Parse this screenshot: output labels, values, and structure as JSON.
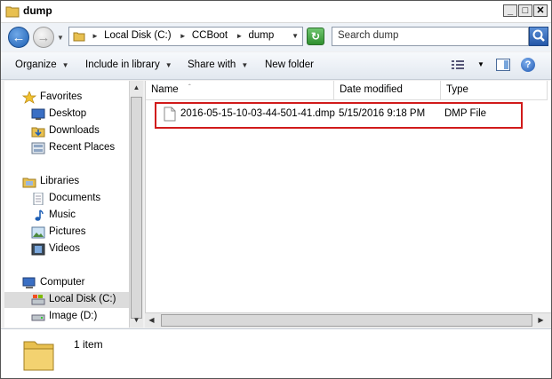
{
  "window": {
    "title": "dump",
    "minimize": "_",
    "maximize": "□",
    "close": "✕"
  },
  "address": {
    "crumbs": [
      "Local Disk (C:)",
      "CCBoot",
      "dump"
    ],
    "search_placeholder": "Search dump"
  },
  "toolbar": {
    "organize": "Organize",
    "include_in_library": "Include in library",
    "share_with": "Share with",
    "new_folder": "New folder"
  },
  "nav": {
    "favorites": "Favorites",
    "desktop": "Desktop",
    "downloads": "Downloads",
    "recent_places": "Recent Places",
    "libraries": "Libraries",
    "documents": "Documents",
    "music": "Music",
    "pictures": "Pictures",
    "videos": "Videos",
    "computer": "Computer",
    "local_disk": "Local Disk (C:)",
    "image": "Image (D:)"
  },
  "columns": {
    "name": "Name",
    "date_modified": "Date modified",
    "type": "Type"
  },
  "files": [
    {
      "name": "2016-05-15-10-03-44-501-41.dmp",
      "date_modified": "5/15/2016 9:18 PM",
      "type": "DMP File"
    }
  ],
  "status": {
    "item_count": "1 item"
  },
  "colors": {
    "highlight_border": "#d11a1a",
    "nav_selected": "#dcdcdc"
  }
}
